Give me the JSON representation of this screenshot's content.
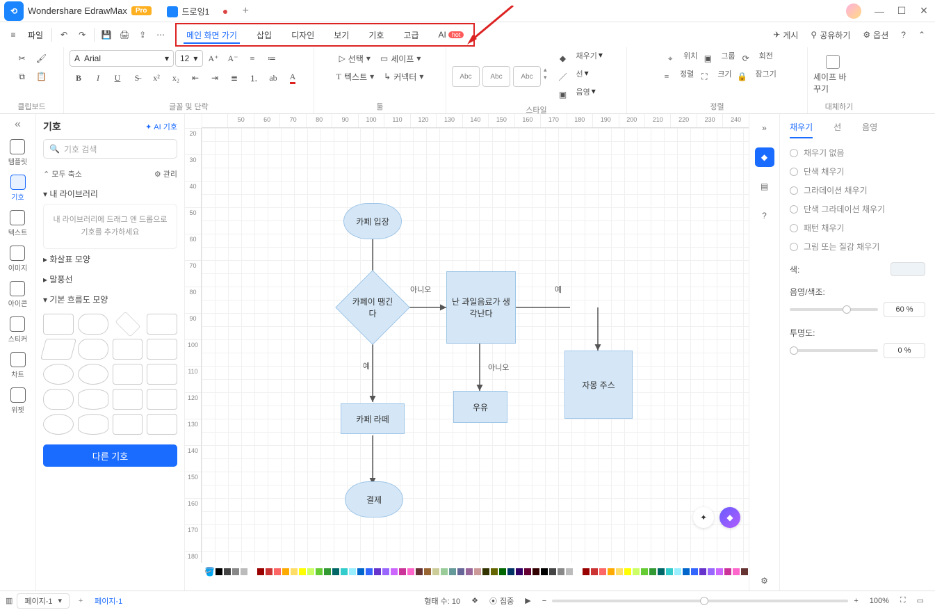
{
  "app": {
    "name": "Wondershare EdrawMax",
    "pro": "Pro",
    "doc_tab": "드로잉1"
  },
  "file_label": "파일",
  "menu": {
    "tabs": [
      "메인 화면 가기",
      "삽입",
      "디자인",
      "보기",
      "기호",
      "고급",
      "AI"
    ],
    "hot": "hot",
    "right": {
      "publish": "게시",
      "share": "공유하기",
      "options": "옵션"
    }
  },
  "ribbon": {
    "font_name": "Arial",
    "font_size": "12",
    "select": "선택",
    "shape": "셰이프",
    "text": "텍스트",
    "connector": "커넥터",
    "style_a": "Abc",
    "style_b": "Abc",
    "style_c": "Abc",
    "fill": "채우기",
    "line": "선",
    "shadow": "음영",
    "pos": "위치",
    "group": "그룹",
    "rotate": "회전",
    "align": "정렬",
    "size": "크기",
    "lock": "잠그기",
    "replace": "셰이프 바꾸기",
    "groups": {
      "clipboard": "클립보드",
      "font": "글꼴 및 단락",
      "tools": "툴",
      "style": "스타일",
      "arrange": "정렬",
      "replace": "대체하기"
    }
  },
  "left_rail": [
    "템플릿",
    "기호",
    "텍스트",
    "이미지",
    "아이콘",
    "스티커",
    "차트",
    "위젯"
  ],
  "symbols": {
    "title": "기호",
    "ai": "AI 기호",
    "search_ph": "기호 검색",
    "collapse_all": "모두 축소",
    "manage": "관리",
    "my_lib": "내 라이브러리",
    "dropzone": "내 라이브러리에 드래그 앤 드롭으로 기호를 추가하세요",
    "sec_arrows": "화살표 모양",
    "sec_callouts": "말풍선",
    "sec_flow": "기본 흐름도 모양",
    "more": "다른 기호"
  },
  "ruler_h": [
    "",
    "50",
    "60",
    "70",
    "80",
    "90",
    "100",
    "110",
    "120",
    "130",
    "140",
    "150",
    "160",
    "170",
    "180",
    "190",
    "200",
    "210",
    "220",
    "230",
    "240"
  ],
  "ruler_v": [
    "20",
    "30",
    "40",
    "50",
    "60",
    "70",
    "80",
    "90",
    "100",
    "110",
    "120",
    "130",
    "140",
    "150",
    "160",
    "170",
    "180"
  ],
  "flow": {
    "start": "카페 입장",
    "decision": "카페이 땡긴다",
    "fruit": "난 과일음료가 생각난다",
    "milk": "우유",
    "latte": "카페 라떼",
    "grapefruit": "자몽 주스",
    "pay": "결제",
    "no": "아니오",
    "yes": "예"
  },
  "right_panel": {
    "tabs": [
      "채우기",
      "선",
      "음영"
    ],
    "opts": [
      "채우기 없음",
      "단색 채우기",
      "그라데이션 채우기",
      "단색 그라데이션 채우기",
      "패턴 채우기",
      "그림 또는 질감 채우기"
    ],
    "color_label": "색:",
    "tint_label": "음영/색조:",
    "tint_val": "60 %",
    "opacity_label": "투명도:",
    "opacity_val": "0 %"
  },
  "status": {
    "page_sel": "페이지-1",
    "page_tab": "페이지-1",
    "count": "형태 수: 10",
    "focus": "집중",
    "zoom": "100%"
  },
  "color_palette": [
    "#000",
    "#444",
    "#888",
    "#bbb",
    "#fff",
    "#900",
    "#c33",
    "#f66",
    "#fa0",
    "#fd6",
    "#ff0",
    "#cf6",
    "#6c3",
    "#393",
    "#066",
    "#3cc",
    "#9ef",
    "#06c",
    "#36f",
    "#63c",
    "#96f",
    "#c6f",
    "#c39",
    "#f6c",
    "#633",
    "#963",
    "#cc9",
    "#9c9",
    "#699",
    "#669",
    "#969",
    "#c99",
    "#330",
    "#660",
    "#060",
    "#036",
    "#306",
    "#603",
    "#300"
  ]
}
